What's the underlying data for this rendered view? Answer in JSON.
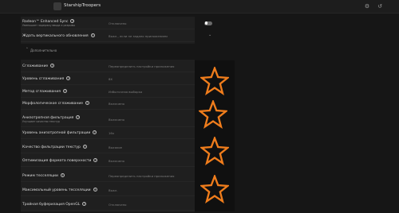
{
  "app": {
    "title": "StarshipTroopers"
  },
  "top_controls": {
    "settings_icon": "gear-icon",
    "reset_icon": "undo-icon"
  },
  "top_rows": [
    {
      "label": "Radeon™ Enhanced Sync",
      "sub": "Уменьшает задержку ввода и разрывы",
      "value": "Отключено",
      "control": "toggle-off"
    },
    {
      "label": "Ждать вертикального обновления",
      "value": "Выкл., если не задано приложением",
      "control": "dropdown"
    }
  ],
  "section": {
    "title": "Дополнительно"
  },
  "rows": [
    {
      "label": "Сглаживание",
      "value": "Переопределить настройки приложения",
      "control": "dropdown"
    },
    {
      "label": "Уровень сглаживания",
      "value": "8X",
      "control": "dropdown"
    },
    {
      "label": "Метод сглаживания",
      "value": "Избыточная выборка",
      "control": "dropdown"
    },
    {
      "label": "Морфологическое сглаживание",
      "value": "Включено",
      "control": "toggle-on"
    },
    {
      "label": "Анизотропная фильтрация",
      "sub": "Улучшает качество текстур",
      "value": "Включено",
      "control": "toggle-on"
    },
    {
      "label": "Уровень анизотропной фильтрации",
      "value": "16x",
      "control": "dropdown"
    },
    {
      "label": "Качество фильтрации текстур",
      "value": "Высокое",
      "control": "dropdown"
    },
    {
      "label": "Оптимизация формата поверхности",
      "value": "Включено",
      "control": "toggle-on"
    },
    {
      "label": "Режим тесселяции",
      "value": "Переопределить настройки приложения",
      "control": "dropdown"
    },
    {
      "label": "Максимальный уровень тесселяции",
      "value": "Выкл.",
      "control": "dropdown"
    },
    {
      "label": "Тройная буферизация OpenGL",
      "value": "Отключено",
      "control": "toggle-off"
    }
  ],
  "annotations": {
    "star_color": "#f07d1c",
    "toggle_on_color": "#d4143f"
  }
}
